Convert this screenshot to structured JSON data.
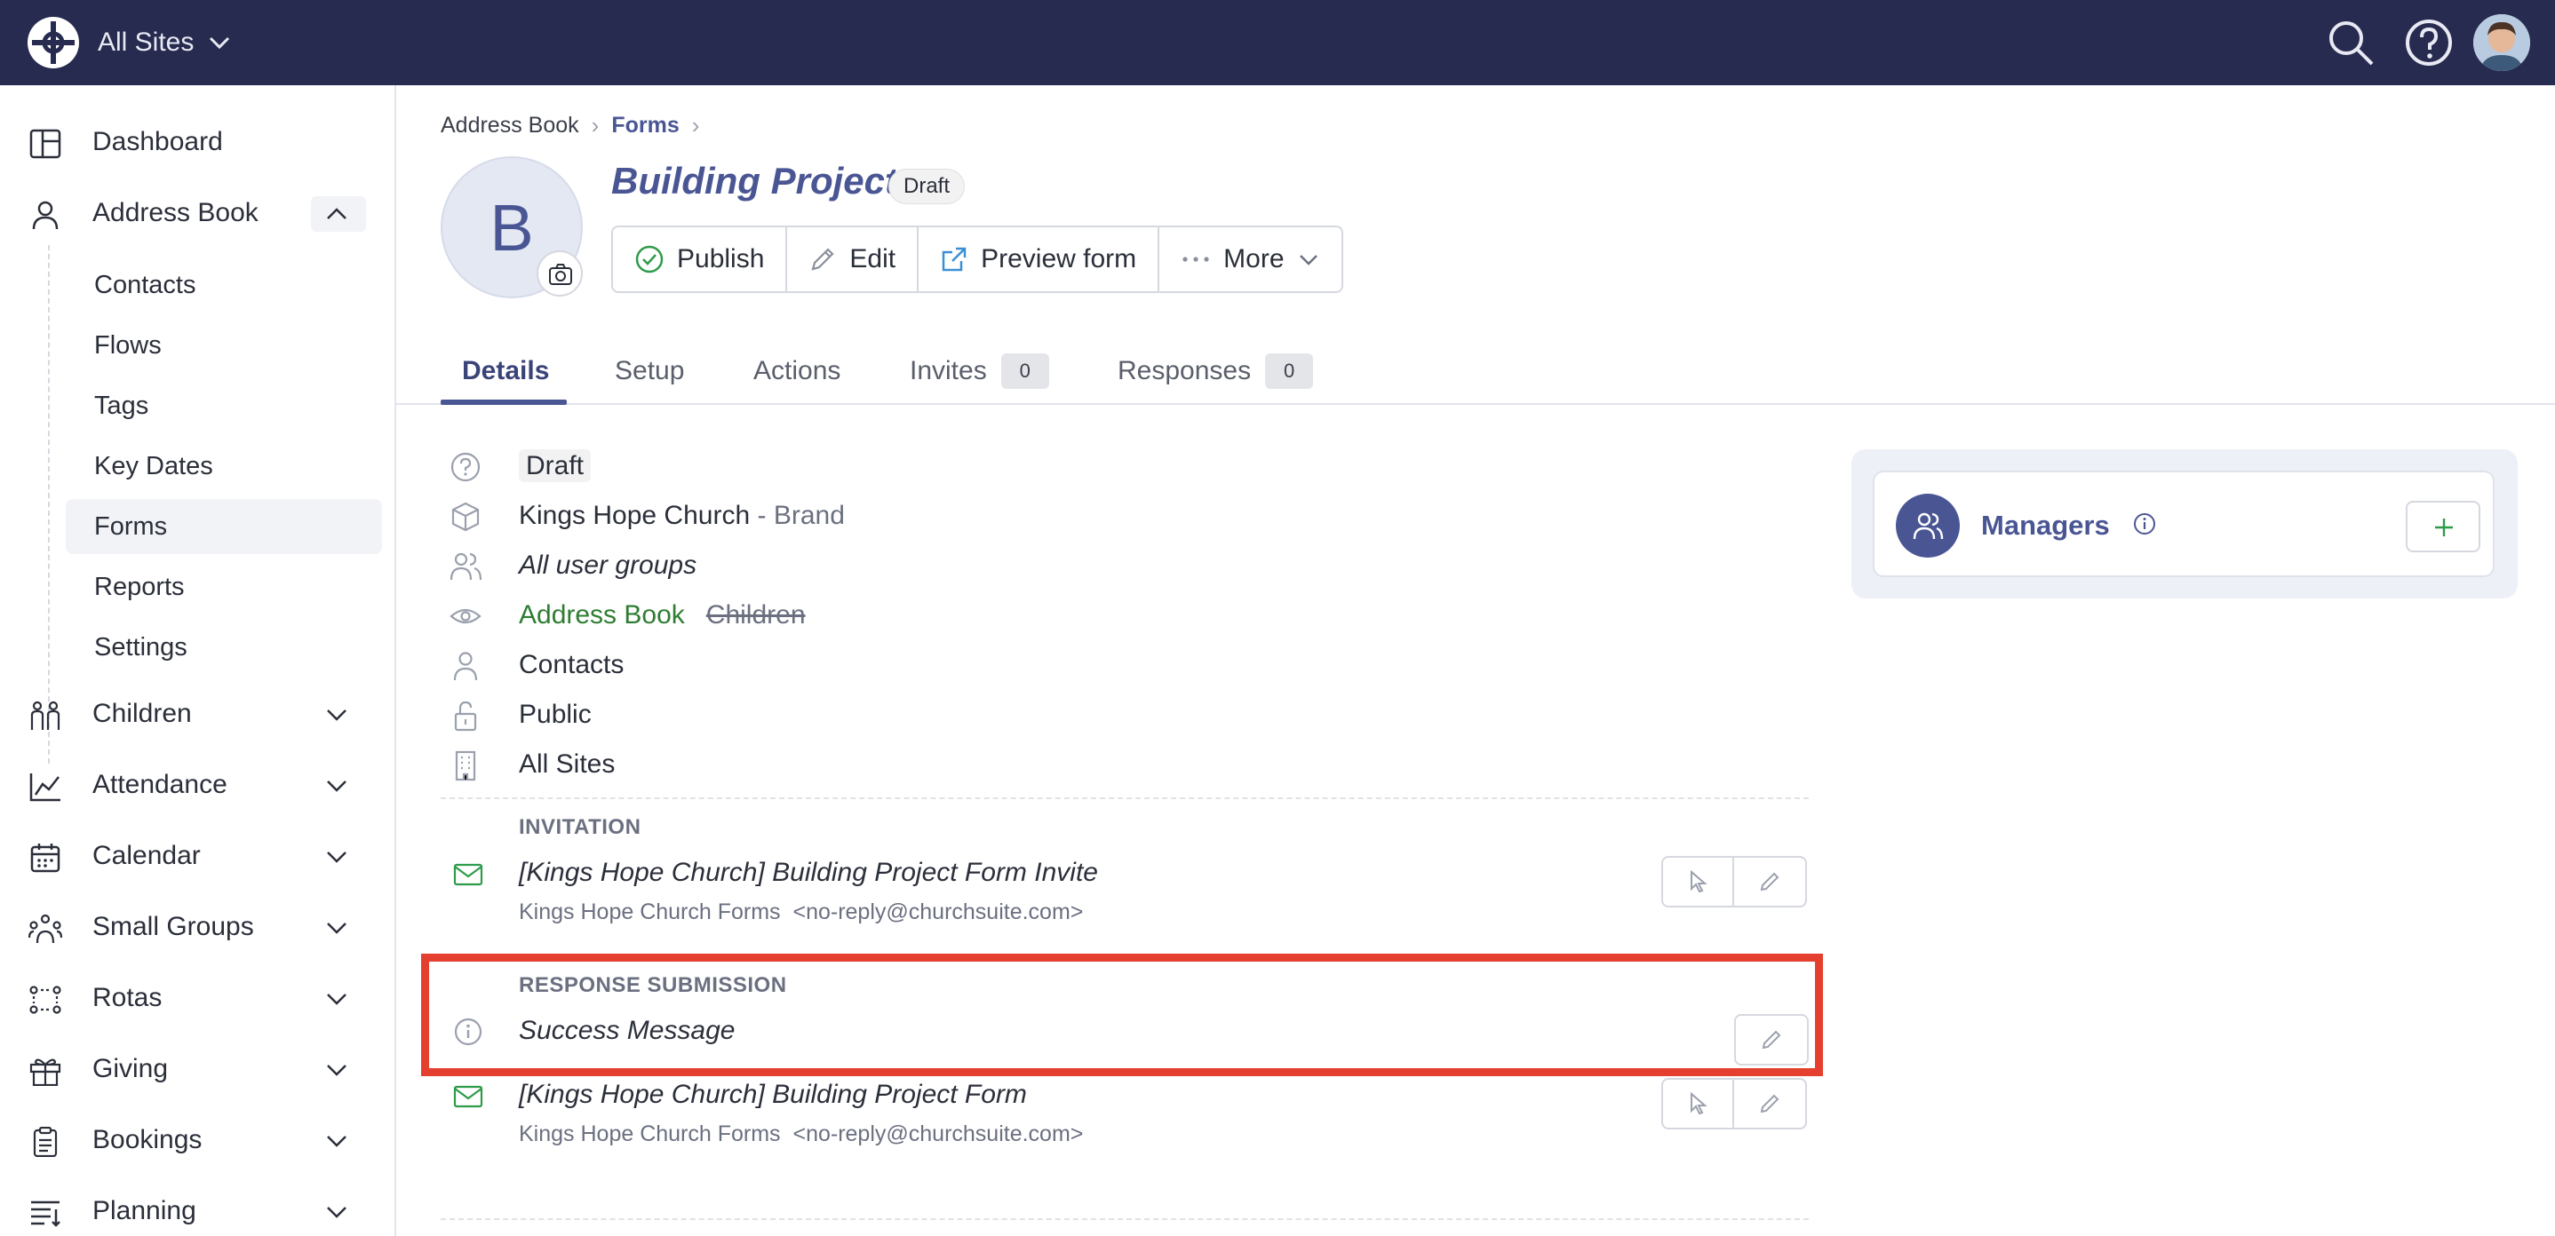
{
  "topbar": {
    "site_switcher": "All Sites",
    "icons": [
      "app-logo-icon",
      "search-icon",
      "help-icon",
      "user-avatar"
    ]
  },
  "sidebar": {
    "items": [
      {
        "label": "Dashboard",
        "icon": "dashboard-icon"
      },
      {
        "label": "Address Book",
        "icon": "person-icon",
        "expanded": true
      },
      {
        "label": "Children",
        "icon": "children-icon"
      },
      {
        "label": "Attendance",
        "icon": "chart-icon"
      },
      {
        "label": "Calendar",
        "icon": "calendar-icon"
      },
      {
        "label": "Small Groups",
        "icon": "group-icon"
      },
      {
        "label": "Rotas",
        "icon": "rotas-icon"
      },
      {
        "label": "Giving",
        "icon": "gift-icon"
      },
      {
        "label": "Bookings",
        "icon": "clipboard-icon"
      },
      {
        "label": "Planning",
        "icon": "planning-icon"
      }
    ],
    "sub_items": [
      "Contacts",
      "Flows",
      "Tags",
      "Key Dates",
      "Forms",
      "Reports",
      "Settings"
    ],
    "active_sub": "Forms"
  },
  "breadcrumb": {
    "parent": "Address Book",
    "current": "Forms"
  },
  "form": {
    "avatar_letter": "B",
    "title": "Building Project",
    "status_badge": "Draft",
    "actions": {
      "publish": "Publish",
      "edit": "Edit",
      "preview": "Preview form",
      "more": "More"
    }
  },
  "tabs": [
    {
      "label": "Details",
      "active": true
    },
    {
      "label": "Setup"
    },
    {
      "label": "Actions"
    },
    {
      "label": "Invites",
      "count": "0"
    },
    {
      "label": "Responses",
      "count": "0"
    }
  ],
  "details": {
    "status": "Draft",
    "brand_name": "Kings Hope Church",
    "brand_suffix": "- Brand",
    "user_groups": "All user groups",
    "visibility_active": "Address Book",
    "visibility_excluded": "Children",
    "record_type": "Contacts",
    "access": "Public",
    "sites": "All Sites"
  },
  "invitation": {
    "section_label": "INVITATION",
    "subject": "[Kings Hope Church] Building Project Form Invite",
    "sender_name": "Kings Hope Church Forms",
    "sender_email": "<no-reply@churchsuite.com>"
  },
  "response_submission": {
    "section_label": "RESPONSE SUBMISSION",
    "success_message": "Success Message",
    "email_subject": "[Kings Hope Church] Building Project Form",
    "sender_name": "Kings Hope Church Forms",
    "sender_email": "<no-reply@churchsuite.com>"
  },
  "managers": {
    "label": "Managers"
  },
  "colors": {
    "topbar": "#262b4f",
    "accent": "#4a5694",
    "highlight": "#e5402f",
    "success": "#2e7d32"
  }
}
